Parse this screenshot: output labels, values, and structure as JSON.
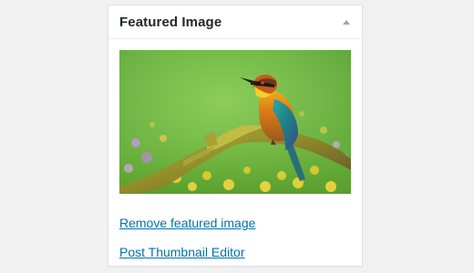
{
  "panel": {
    "title": "Featured Image",
    "toggle_icon": "triangle-up-icon"
  },
  "image": {
    "subject": "bird-on-branch-photo"
  },
  "links": {
    "remove": "Remove featured image",
    "editor": "Post Thumbnail Editor"
  },
  "colors": {
    "link": "#0073aa",
    "title": "#23282d",
    "toggle": "#a0a5aa",
    "page_background": "#f1f1f1"
  }
}
